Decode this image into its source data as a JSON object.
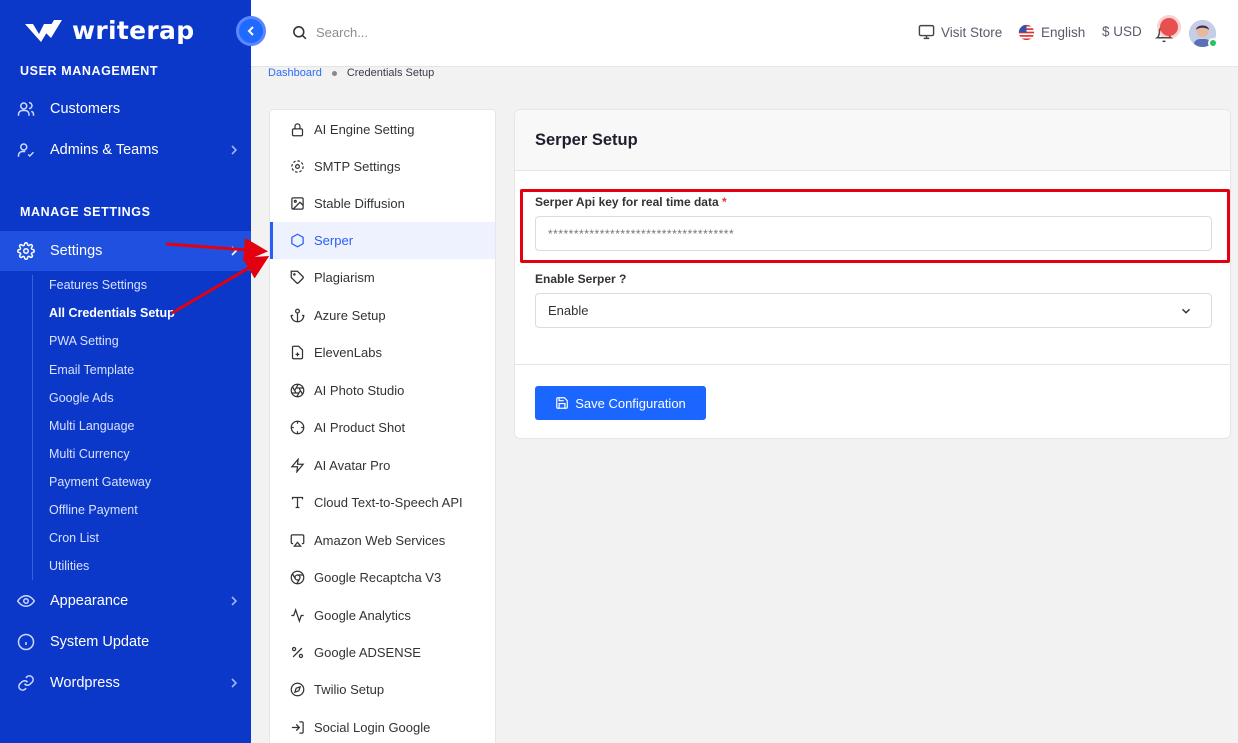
{
  "brand": {
    "name": "writerap"
  },
  "sidebar": {
    "section_user": "USER MANAGEMENT",
    "section_settings": "MANAGE SETTINGS",
    "items": [
      {
        "label": "Customers",
        "icon": "users-icon"
      },
      {
        "label": "Admins & Teams",
        "icon": "user-check-icon"
      },
      {
        "label": "Settings",
        "icon": "gear-icon"
      },
      {
        "label": "Appearance",
        "icon": "eye-icon"
      },
      {
        "label": "System Update",
        "icon": "info-icon"
      },
      {
        "label": "Wordpress",
        "icon": "link-icon"
      }
    ],
    "sub_items": [
      "Features Settings",
      "All Credentials Setup",
      "PWA Setting",
      "Email Template",
      "Google Ads",
      "Multi Language",
      "Multi Currency",
      "Payment Gateway",
      "Offline Payment",
      "Cron List",
      "Utilities"
    ]
  },
  "topbar": {
    "search_placeholder": "Search...",
    "visit_store": "Visit Store",
    "language": "English",
    "currency": "$ USD"
  },
  "breadcrumb": {
    "home": "Dashboard",
    "current": "Credentials Setup"
  },
  "settings_menu": [
    {
      "label": "AI Engine Setting",
      "icon": "lock-icon"
    },
    {
      "label": "SMTP Settings",
      "icon": "gear-icon"
    },
    {
      "label": "Stable Diffusion",
      "icon": "image-icon"
    },
    {
      "label": "Serper",
      "icon": "hexagon-icon"
    },
    {
      "label": "Plagiarism",
      "icon": "tag-icon"
    },
    {
      "label": "Azure Setup",
      "icon": "anchor-icon"
    },
    {
      "label": "ElevenLabs",
      "icon": "file-plus-icon"
    },
    {
      "label": "AI Photo Studio",
      "icon": "aperture-icon"
    },
    {
      "label": "AI Product Shot",
      "icon": "crosshair-icon"
    },
    {
      "label": "AI Avatar Pro",
      "icon": "zap-icon"
    },
    {
      "label": "Cloud Text-to-Speech API",
      "icon": "type-icon"
    },
    {
      "label": "Amazon Web Services",
      "icon": "airplay-icon"
    },
    {
      "label": "Google Recaptcha V3",
      "icon": "chrome-icon"
    },
    {
      "label": "Google Analytics",
      "icon": "activity-icon"
    },
    {
      "label": "Google ADSENSE",
      "icon": "percent-icon"
    },
    {
      "label": "Twilio Setup",
      "icon": "compass-icon"
    },
    {
      "label": "Social Login Google",
      "icon": "log-in-icon"
    }
  ],
  "serper": {
    "title": "Serper Setup",
    "api_key_label": "Serper Api key for real time data",
    "required_mark": "*",
    "api_key_value": "************************************",
    "enable_label": "Enable Serper ?",
    "enable_value": "Enable",
    "save_label": "Save Configuration"
  },
  "colors": {
    "sidebar_bg": "#0b38c9",
    "accent": "#1b66ff",
    "highlight": "#e3000f",
    "annotation_arrow": "#e3000f"
  }
}
